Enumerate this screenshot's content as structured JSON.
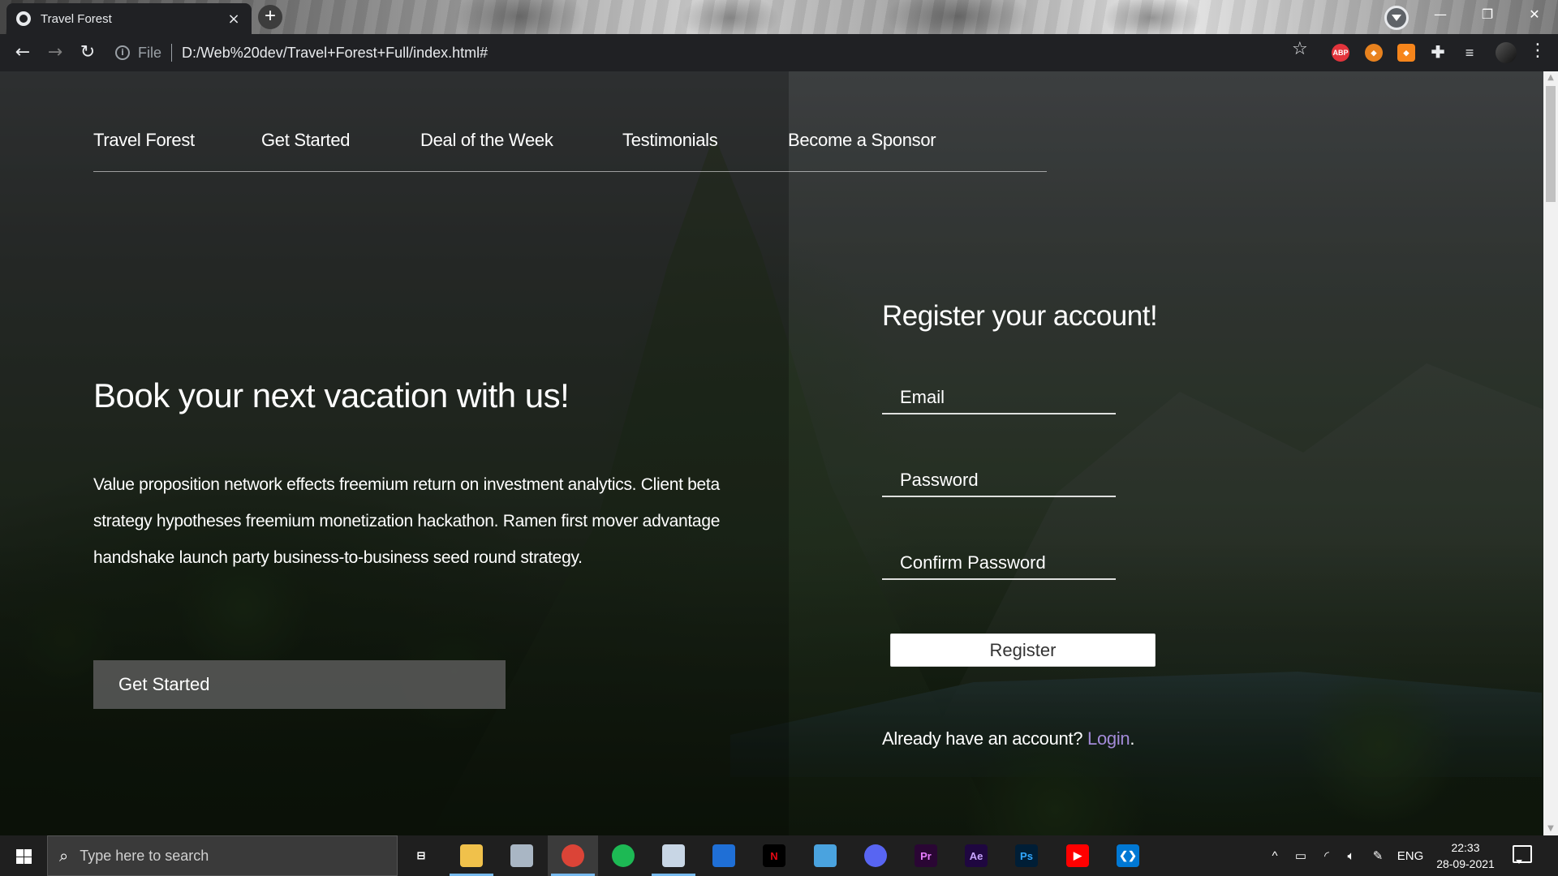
{
  "browser": {
    "tab_title": "Travel Forest",
    "tab_close": "×",
    "new_tab": "+",
    "scheme": "File",
    "url": "D:/Web%20dev/Travel+Forest+Full/index.html#",
    "nav": {
      "back": "←",
      "forward": "→",
      "reload": "↻"
    },
    "window": {
      "minimize": "—",
      "maximize": "❐",
      "close": "✕"
    },
    "extensions": {
      "abp": "ABP"
    }
  },
  "site": {
    "nav": [
      "Travel Forest",
      "Get Started",
      "Deal of the Week",
      "Testimonials",
      "Become a Sponsor"
    ],
    "hero": {
      "title": "Book your next vacation with us!",
      "text": "Value proposition network effects freemium return on investment analytics. Client beta strategy hypotheses freemium monetization hackathon. Ramen first mover advantage handshake launch party business-to-business seed round strategy.",
      "button": "Get Started"
    },
    "register": {
      "title": "Register your account!",
      "email_placeholder": "Email",
      "password_placeholder": "Password",
      "confirm_placeholder": "Confirm Password",
      "button": "Register",
      "login_prompt": "Already have an account? ",
      "login_link": "Login",
      "login_suffix": ".",
      "link_color": "#a38bd8"
    }
  },
  "taskbar": {
    "search_placeholder": "Type here to search",
    "apps": [
      {
        "name": "task-view",
        "glyph": "⊟",
        "bg": "transparent",
        "fg": "#ffffff"
      },
      {
        "name": "file-explorer",
        "glyph": "",
        "bg": "#f0c14b",
        "fg": "#000000"
      },
      {
        "name": "app-generic",
        "glyph": "",
        "bg": "#a9b6c4",
        "fg": "#000000"
      },
      {
        "name": "chrome",
        "glyph": "",
        "bg": "#db4437",
        "fg": "#ffffff"
      },
      {
        "name": "spotify",
        "glyph": "",
        "bg": "#1db954",
        "fg": "#000000"
      },
      {
        "name": "paint",
        "glyph": "",
        "bg": "#c8d6e5",
        "fg": "#000000"
      },
      {
        "name": "whiteboard",
        "glyph": "",
        "bg": "#1f6fd6",
        "fg": "#ffffff"
      },
      {
        "name": "netflix",
        "glyph": "N",
        "bg": "#000000",
        "fg": "#e50914"
      },
      {
        "name": "control-panel",
        "glyph": "",
        "bg": "#4aa3df",
        "fg": "#ffffff"
      },
      {
        "name": "discord",
        "glyph": "",
        "bg": "#5865f2",
        "fg": "#ffffff"
      },
      {
        "name": "premiere-pro",
        "glyph": "Pr",
        "bg": "#2a0634",
        "fg": "#e77cff"
      },
      {
        "name": "after-effects",
        "glyph": "Ae",
        "bg": "#1f0740",
        "fg": "#c8a6ff"
      },
      {
        "name": "photoshop",
        "glyph": "Ps",
        "bg": "#001e36",
        "fg": "#31a8ff"
      },
      {
        "name": "youtube",
        "glyph": "▶",
        "bg": "#ff0000",
        "fg": "#ffffff"
      },
      {
        "name": "vs-code",
        "glyph": "❮❯",
        "bg": "#0078d4",
        "fg": "#ffffff"
      }
    ],
    "tray": {
      "chevron": "^",
      "language": "ENG"
    },
    "clock": {
      "time": "22:33",
      "date": "28-09-2021"
    }
  }
}
